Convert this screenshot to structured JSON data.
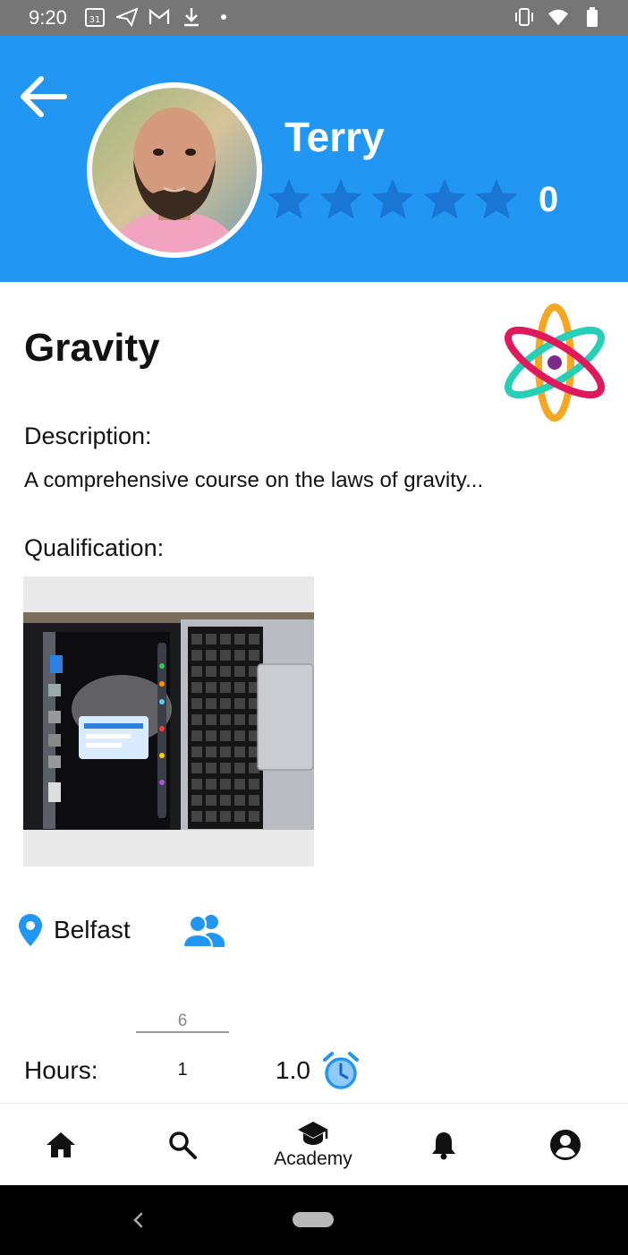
{
  "status_bar": {
    "time": "9:20",
    "calendar_day": "31"
  },
  "profile": {
    "name": "Terry",
    "rating_count": "0",
    "star_color": "#1976d2",
    "header_color": "#2196f3"
  },
  "course": {
    "title": "Gravity",
    "description_label": "Description:",
    "description": "A comprehensive course on the laws of gravity...",
    "qualification_label": "Qualification:"
  },
  "location": {
    "city": "Belfast"
  },
  "hours": {
    "label": "Hours:",
    "top_value": "6",
    "bottom_value": "1",
    "value": "1.0"
  },
  "nav": {
    "home_icon": "home-icon",
    "search_icon": "search-icon",
    "academy_label": "Academy",
    "notifications_icon": "bell-icon",
    "account_icon": "account-icon"
  }
}
